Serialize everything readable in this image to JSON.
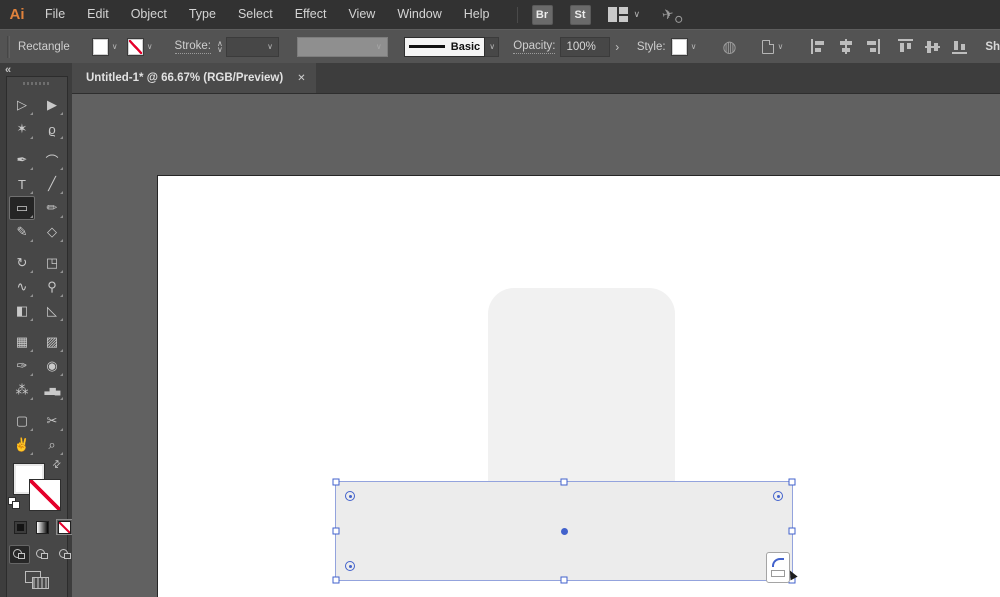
{
  "menubar": {
    "logo": "Ai",
    "items": [
      "File",
      "Edit",
      "Object",
      "Type",
      "Select",
      "Effect",
      "View",
      "Window",
      "Help"
    ],
    "brushes_button": "Br",
    "styles_button": "St"
  },
  "controlbar": {
    "tool_label": "Rectangle",
    "stroke_label": "Stroke:",
    "brush_name": "Basic",
    "opacity_label": "Opacity:",
    "opacity_value": "100%",
    "style_label": "Style:",
    "shape_label_clipped": "Sh"
  },
  "tabbar": {
    "title": "Untitled-1* @ 66.67% (RGB/Preview)"
  },
  "icons": {
    "collapse": "«",
    "close": "✕",
    "chevron_down": "∨",
    "stepper_up": "∧",
    "stepper_down": "∨",
    "expander": "›",
    "swap": "⇄",
    "globe": "◍",
    "sync": "✈"
  },
  "tools": {
    "groups": [
      [
        {
          "name": "selection",
          "glyph": "▷"
        },
        {
          "name": "direct-selection",
          "glyph": "▶"
        },
        {
          "name": "magic-wand",
          "glyph": "✶"
        },
        {
          "name": "lasso",
          "glyph": "ϱ"
        }
      ],
      [
        {
          "name": "pen",
          "glyph": "✒"
        },
        {
          "name": "curvature",
          "glyph": "⌒"
        },
        {
          "name": "type",
          "glyph": "T"
        },
        {
          "name": "line-segment",
          "glyph": "╱"
        },
        {
          "name": "rectangle",
          "glyph": "▭",
          "selected": true
        },
        {
          "name": "paintbrush",
          "glyph": "✏"
        },
        {
          "name": "shaper",
          "glyph": "✎"
        },
        {
          "name": "eraser",
          "glyph": "◇"
        }
      ],
      [
        {
          "name": "rotate",
          "glyph": "↻"
        },
        {
          "name": "scale",
          "glyph": "◳"
        },
        {
          "name": "width",
          "glyph": "∿"
        },
        {
          "name": "puppet-warp",
          "glyph": "⚲"
        },
        {
          "name": "shape-builder",
          "glyph": "◧"
        },
        {
          "name": "perspective-grid",
          "glyph": "◺"
        }
      ],
      [
        {
          "name": "mesh",
          "glyph": "▦"
        },
        {
          "name": "gradient",
          "glyph": "▨"
        },
        {
          "name": "eyedropper",
          "glyph": "✑"
        },
        {
          "name": "blend",
          "glyph": "◉"
        },
        {
          "name": "symbol-sprayer",
          "glyph": "⁂"
        },
        {
          "name": "column-graph",
          "glyph": "▃▆▄",
          "small": true
        }
      ],
      [
        {
          "name": "artboard",
          "glyph": "▢"
        },
        {
          "name": "slice",
          "glyph": "✂"
        },
        {
          "name": "hand",
          "glyph": "✌"
        },
        {
          "name": "zoom",
          "glyph": "⌕"
        }
      ]
    ]
  },
  "colors": {
    "selection_blue": "#4262cc",
    "selection_line": "#93a3dd",
    "none_red": "#e4002b",
    "accent_orange": "#e0823c",
    "shape_gray": "#f1f1f1",
    "selected_shape_gray": "#ececec"
  }
}
